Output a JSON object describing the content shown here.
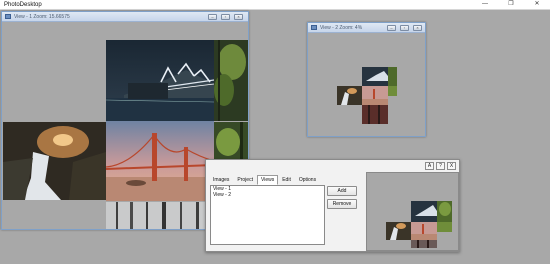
{
  "app": {
    "title": "PhotoDesktop",
    "controls": {
      "minimize": "—",
      "maximize": "❐",
      "close": "✕"
    }
  },
  "view1": {
    "title": "View - 1 Zoom: 15.66575",
    "buttons": {
      "minimize": "–",
      "restore": "▫",
      "close": "×"
    }
  },
  "view2": {
    "title": "View - 2 Zoom: 4%",
    "buttons": {
      "minimize": "–",
      "restore": "▫",
      "close": "×"
    }
  },
  "panel": {
    "buttons": {
      "a": "A",
      "help": "?",
      "close": "X"
    },
    "tabs": [
      "Images",
      "Project",
      "Views",
      "Edit",
      "Options"
    ],
    "active_tab": "Views",
    "views_list": [
      "View - 1",
      "View - 2"
    ],
    "add_label": "Add",
    "remove_label": "Remove"
  },
  "colors": {
    "workspace": "#a8a8a8",
    "window_border": "#7fa0c8",
    "panel_background": "#f2f2f2"
  }
}
